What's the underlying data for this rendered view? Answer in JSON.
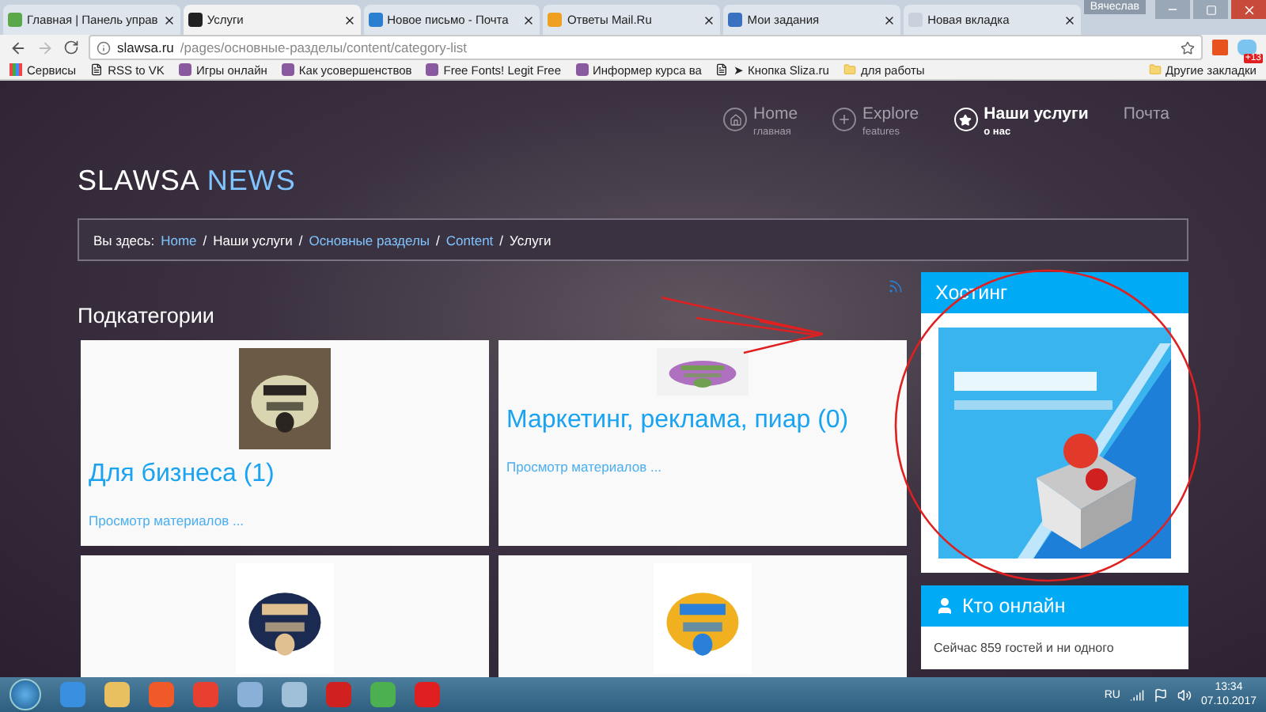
{
  "browser": {
    "user": "Вячеслав",
    "tabs": [
      {
        "title": "Главная | Панель управ",
        "selected": false,
        "color": "#5aa84a"
      },
      {
        "title": "Услуги",
        "selected": true,
        "color": "#222222"
      },
      {
        "title": "Новое письмо - Почта",
        "selected": false,
        "color": "#2a7fd0"
      },
      {
        "title": "Ответы Mail.Ru",
        "selected": false,
        "color": "#f0a020"
      },
      {
        "title": "Мои задания",
        "selected": false,
        "color": "#3a70c0"
      },
      {
        "title": "Новая вкладка",
        "selected": false,
        "color": "#c8d1dc"
      }
    ],
    "url_host": "slawsa.ru",
    "url_path": "/pages/основные-разделы/content/category-list",
    "badge": "+13",
    "bookmarks": [
      {
        "title": "Сервисы",
        "kind": "apps"
      },
      {
        "title": "RSS to VK",
        "kind": "page"
      },
      {
        "title": "Игры онлайн",
        "kind": "site"
      },
      {
        "title": "Как усовершенствов",
        "kind": "site"
      },
      {
        "title": "Free Fonts! Legit Free",
        "kind": "site"
      },
      {
        "title": "Информер курса ва",
        "kind": "site"
      },
      {
        "title": "➤ Кнопка Sliza.ru",
        "kind": "page"
      },
      {
        "title": "для работы",
        "kind": "folder"
      }
    ],
    "other_bookmarks": "Другие закладки"
  },
  "site": {
    "logo": {
      "main": "SLAWSA",
      "accent": "NEWS"
    },
    "nav": [
      {
        "title": "Home",
        "subtitle": "главная",
        "kind": "home",
        "selected": false
      },
      {
        "title": "Explore",
        "subtitle": "features",
        "kind": "plus",
        "selected": false
      },
      {
        "title": "Наши услуги",
        "subtitle": "о нас",
        "kind": "star",
        "selected": true
      },
      {
        "title": "Почта",
        "kind": "plain",
        "selected": false
      }
    ],
    "breadcrumb": [
      {
        "text": "Вы здесь:",
        "kind": "label"
      },
      {
        "text": "Home",
        "kind": "link"
      },
      {
        "text": "/",
        "kind": "separator"
      },
      {
        "text": "Наши услуги",
        "kind": "current"
      },
      {
        "text": "/",
        "kind": "separator"
      },
      {
        "text": "Основные разделы",
        "kind": "link"
      },
      {
        "text": "/",
        "kind": "separator"
      },
      {
        "text": "Content",
        "kind": "link"
      },
      {
        "text": "/",
        "kind": "separator"
      },
      {
        "text": "Услуги",
        "kind": "current"
      }
    ],
    "heading": "Подкатегории",
    "categories": [
      {
        "title": "Для бизнеса",
        "count": "(1)",
        "link": "Просмотр материалов ..."
      },
      {
        "title": "Маркетинг, реклама, пиар",
        "count": "(0)",
        "link": "Просмотр материалов ..."
      },
      {
        "kind": "picture"
      },
      {
        "kind": "picture"
      }
    ],
    "modules": [
      {
        "title": "Хостинг",
        "kind": "banner"
      },
      {
        "title": "Кто онлайн",
        "kind": "users",
        "text": "Сейчас 859 гостей и ни одного"
      }
    ]
  },
  "taskbar": {
    "language": "RU",
    "time": "13:34",
    "date": "07.10.2017"
  }
}
